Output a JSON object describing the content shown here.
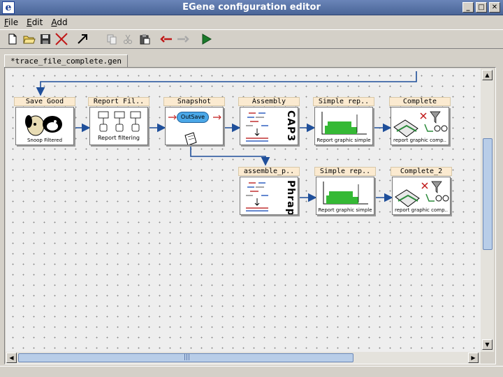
{
  "window": {
    "title": "EGene configuration editor",
    "min_glyph": "_",
    "max_glyph": "□",
    "close_glyph": "✕"
  },
  "menu": [
    {
      "label": "File"
    },
    {
      "label": "Edit"
    },
    {
      "label": "Add"
    }
  ],
  "toolbar": [
    {
      "icon": "new-file-icon"
    },
    {
      "icon": "open-folder-icon"
    },
    {
      "icon": "save-disk-icon"
    },
    {
      "icon": "delete-x-icon"
    },
    {
      "icon": "connect-arrow-icon"
    },
    {
      "icon": "copy-icon"
    },
    {
      "icon": "cut-icon"
    },
    {
      "icon": "paste-icon"
    },
    {
      "icon": "undo-arrow-icon"
    },
    {
      "icon": "redo-arrow-icon"
    },
    {
      "icon": "run-play-icon"
    }
  ],
  "tab": {
    "label": "*trace_file_complete.gen"
  },
  "nodes": {
    "save_good": {
      "label": "Save Good",
      "caption": "Snoop Filtered"
    },
    "report_filter": {
      "label": "Report Fil..",
      "caption": "Report filtering"
    },
    "snapshot": {
      "label": "Snapshot",
      "chip": "OutSave"
    },
    "assembly": {
      "label": "Assembly",
      "word": "CAP3"
    },
    "simple_rep_1": {
      "label": "Simple rep..",
      "caption": "Report graphic simple"
    },
    "complete": {
      "label": "Complete",
      "caption": "report graphic comp.."
    },
    "assemble_p": {
      "label": "assemble_p..",
      "word": "Phrap"
    },
    "simple_rep_2": {
      "label": "Simple rep..",
      "caption": "Report graphic simple"
    },
    "complete_2": {
      "label": "Complete_2",
      "caption": "report graphic comp.."
    }
  },
  "colors": {
    "connector": "#1f4f9a",
    "label_bg": "#fbead0",
    "scroll_thumb": "#b8cde8",
    "chart_green": "#35b935"
  }
}
